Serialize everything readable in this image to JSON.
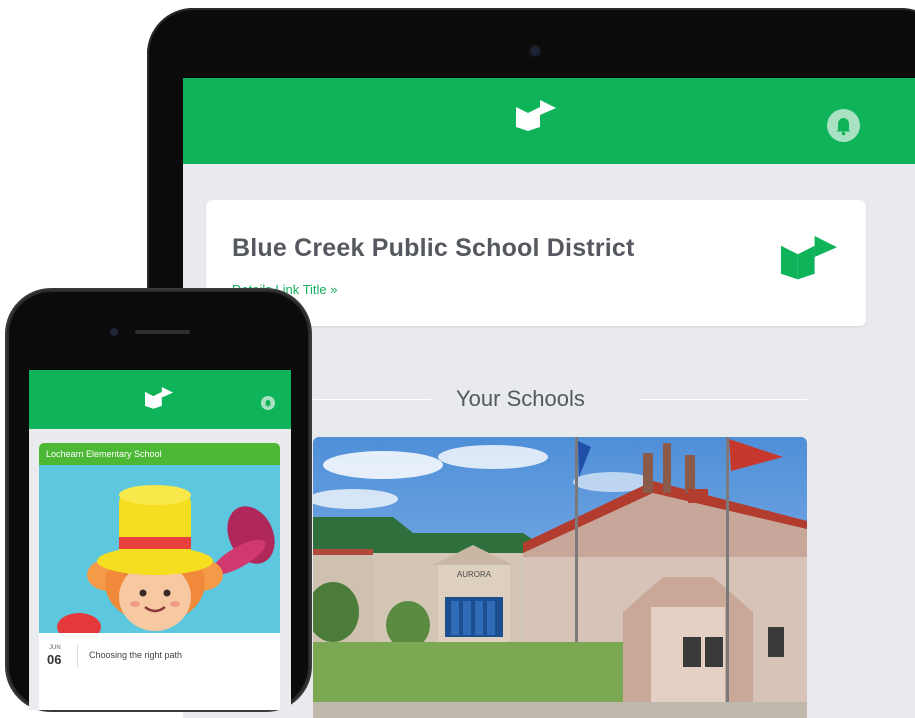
{
  "tablet": {
    "district_title": "Blue Creek Public School District",
    "details_link": "Details Link Title »",
    "section_title": "Your Schools",
    "school_sign": "AURORA"
  },
  "phone": {
    "school_name": "Lochearn Elementary School",
    "event_month": "JUN",
    "event_day": "06",
    "event_title": "Choosing the right path"
  },
  "icons": {
    "brand_logo": "brand-logo-icon",
    "notifications": "bell-icon"
  },
  "colors": {
    "brand_green": "#0fb35a",
    "card_bar_green": "#4cb836",
    "link_green": "#17b160",
    "bell_bg": "#a9e2c3",
    "screen_bg": "#e8eaee",
    "title_gray": "#55595f"
  }
}
